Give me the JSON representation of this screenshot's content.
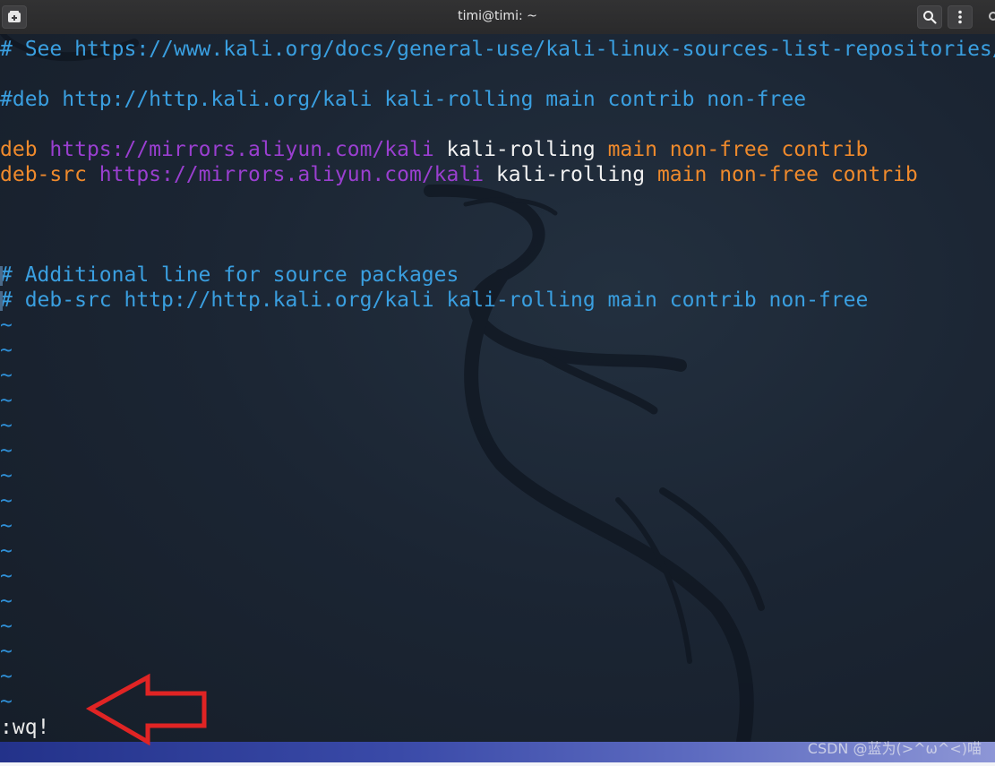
{
  "window": {
    "title": "timi@timi: ~",
    "new_tab_icon": "new-tab-icon",
    "search_icon": "search-icon",
    "menu_icon": "kebab-menu-icon"
  },
  "editor": {
    "lines": [
      {
        "type": "comment",
        "text": "# See https://www.kali.org/docs/general-use/kali-linux-sources-list-repositories/"
      },
      {
        "type": "blank",
        "text": ""
      },
      {
        "type": "comment",
        "text": "#deb http://http.kali.org/kali kali-rolling main contrib non-free"
      },
      {
        "type": "blank",
        "text": ""
      },
      {
        "type": "source",
        "keyword": "deb",
        "url": "https://mirrors.aliyun.com/kali",
        "suite": "kali-rolling",
        "components": "main non-free contrib"
      },
      {
        "type": "source",
        "keyword": "deb-src",
        "url": "https://mirrors.aliyun.com/kali",
        "suite": "kali-rolling",
        "components": "main non-free contrib"
      },
      {
        "type": "blank",
        "text": ""
      },
      {
        "type": "blank",
        "text": ""
      },
      {
        "type": "blank",
        "text": ""
      },
      {
        "type": "comment",
        "text": "# Additional line for source packages",
        "marker": true
      },
      {
        "type": "comment",
        "text": "# deb-src http://http.kali.org/kali kali-rolling main contrib non-free",
        "marker": true
      }
    ],
    "tilde_rows": [
      "~",
      "~",
      "~",
      "~",
      "~",
      "~",
      "~",
      "~",
      "~",
      "~",
      "~",
      "~",
      "~",
      "~",
      "~",
      "~"
    ],
    "command_line": ":wq!"
  },
  "overlay": {
    "arrow_color": "#e02424",
    "watermark": "CSDN @蓝为(>^ω^<)喵"
  },
  "colors": {
    "background": "#1a2230",
    "comment": "#3a9fe0",
    "keyword": "#ef8a2c",
    "url": "#9a3fd0",
    "plain": "#f2f2f2"
  }
}
